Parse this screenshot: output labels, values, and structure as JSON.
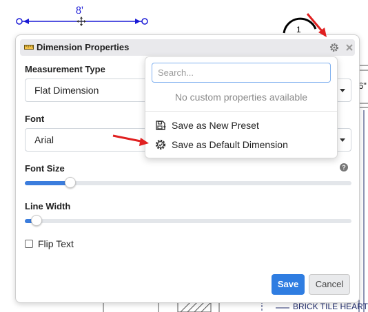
{
  "canvas": {
    "dimension_label": "8'",
    "partial_text_right": "6\"",
    "wall_label": "BRICK TILE HEART",
    "circle_number": "1"
  },
  "dialog": {
    "title": "Dimension Properties",
    "measurement_type": {
      "label": "Measurement Type",
      "value": "Flat Dimension"
    },
    "font": {
      "label": "Font",
      "value": "Arial"
    },
    "font_size": {
      "label": "Font Size",
      "help": "?",
      "fraction": 0.14
    },
    "line_width": {
      "label": "Line Width",
      "fraction": 0.035
    },
    "flip_text": {
      "label": "Flip Text",
      "checked": false
    },
    "save_label": "Save",
    "cancel_label": "Cancel"
  },
  "popup": {
    "search_placeholder": "Search...",
    "empty_message": "No custom properties available",
    "items": [
      {
        "label": "Save as New Preset",
        "icon": "save-preset-icon"
      },
      {
        "label": "Save as Default Dimension",
        "icon": "gear-check-icon"
      }
    ]
  },
  "colors": {
    "accent": "#2f7de1",
    "annotation_arrow": "#e02020",
    "dimension_line": "#1a1ad6"
  }
}
